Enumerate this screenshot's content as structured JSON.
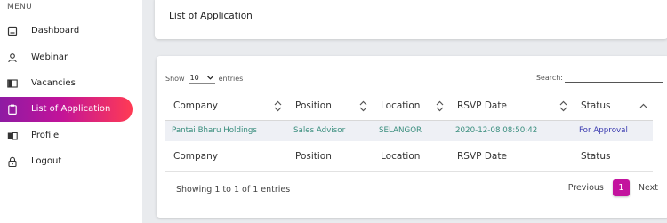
{
  "sidebar": {
    "heading": "MENU",
    "items": [
      {
        "label": "Dashboard",
        "icon": "dashboard-icon",
        "active": false
      },
      {
        "label": "Webinar",
        "icon": "user-icon",
        "active": false
      },
      {
        "label": "Vacancies",
        "icon": "vacancies-icon",
        "active": false
      },
      {
        "label": "List of Application",
        "icon": "clipboard-icon",
        "active": true
      },
      {
        "label": "Profile",
        "icon": "book-icon",
        "active": false
      },
      {
        "label": "Logout",
        "icon": "lock-icon",
        "active": false
      }
    ]
  },
  "page": {
    "title": "List of Application"
  },
  "table_controls": {
    "show_prefix": "Show",
    "show_value": "10",
    "show_suffix": "entries",
    "search_label": "Search:",
    "search_value": ""
  },
  "table": {
    "columns": [
      "Company",
      "Position",
      "Location",
      "RSVP Date",
      "Status"
    ],
    "rows": [
      {
        "company": "Pantai Bharu Holdings",
        "position": "Sales Advisor",
        "location": "SELANGOR",
        "rsvp_date": "2020-12-08 08:50:42",
        "status": "For Approval"
      }
    ],
    "footer": [
      "Company",
      "Position",
      "Location",
      "RSVP Date",
      "Status"
    ]
  },
  "pagination": {
    "info": "Showing 1 to 1 of 1 entries",
    "previous": "Previous",
    "current_page": "1",
    "next": "Next"
  },
  "colors": {
    "active_gradient_start": "#8e1ba3",
    "active_gradient_end": "#ff3b54",
    "page_button": "#c3139e",
    "row_text": "#3a8e7e",
    "status_text": "#3a3ab0"
  }
}
